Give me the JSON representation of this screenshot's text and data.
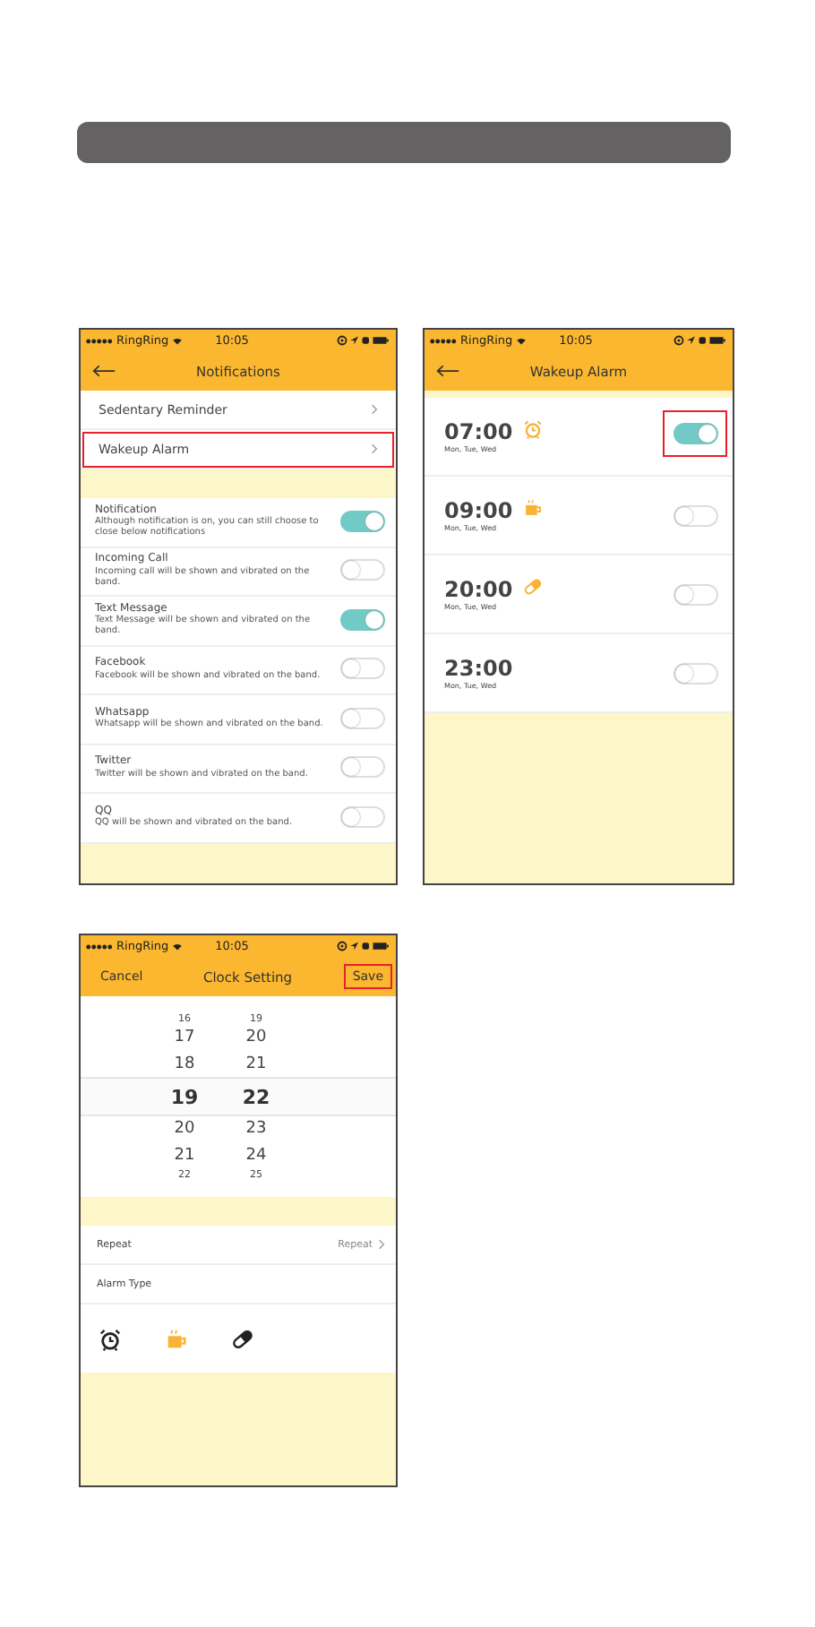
{
  "screens": [
    {
      "kind": "notifications",
      "status_bar": {
        "carrier": "RingRing",
        "time": "10:05"
      },
      "nav": {
        "title": "Notifications"
      },
      "menu": [
        {
          "label": "Sedentary Reminder",
          "highlighted": false
        },
        {
          "label": "Wakeup Alarm",
          "highlighted": true
        }
      ],
      "toggles": [
        {
          "title": "Notification",
          "description": "Although notification is on, you can still choose to close below notifications",
          "on": true
        },
        {
          "title": "Incoming Call",
          "description": "Incoming call will be shown and vibrated on the band.",
          "on": false
        },
        {
          "title": "Text Message",
          "description": "Text Message will be shown and vibrated on the band.",
          "on": true
        },
        {
          "title": "Facebook",
          "description": "Facebook will be shown and vibrated on the band.",
          "on": false
        },
        {
          "title": "Whatsapp",
          "description": "Whatsapp will be shown and vibrated on the band.",
          "on": false
        },
        {
          "title": "Twitter",
          "description": "Twitter will be shown and vibrated on the band.",
          "on": false
        },
        {
          "title": "QQ",
          "description": "QQ will be shown and vibrated on the band.",
          "on": false
        }
      ]
    },
    {
      "kind": "alarms",
      "status_bar": {
        "carrier": "RingRing",
        "time": "10:05"
      },
      "nav": {
        "title": "Wakeup Alarm"
      },
      "alarms": [
        {
          "time": "07:00",
          "days": "Mon, Tue,  Wed",
          "kind": "clock",
          "on": true,
          "highlighted": true
        },
        {
          "time": "09:00",
          "days": "Mon, Tue,  Wed",
          "kind": "cup",
          "on": false,
          "highlighted": false
        },
        {
          "time": "20:00",
          "days": "Mon, Tue,  Wed",
          "kind": "pill",
          "on": false,
          "highlighted": false
        },
        {
          "time": "23:00",
          "days": "Mon, Tue,  Wed",
          "kind": "plain",
          "on": false,
          "highlighted": false
        }
      ]
    },
    {
      "kind": "clock_setting",
      "status_bar": {
        "carrier": "RingRing",
        "time": "10:05"
      },
      "nav": {
        "cancel": "Cancel",
        "title": "Clock Setting",
        "save": "Save",
        "save_highlighted": true
      },
      "picker": [
        {
          "hour": "16",
          "minute": "19",
          "selected": false
        },
        {
          "hour": "17",
          "minute": "20",
          "selected": false
        },
        {
          "hour": "18",
          "minute": "21",
          "selected": false
        },
        {
          "hour": "19",
          "minute": "22",
          "selected": true
        },
        {
          "hour": "20",
          "minute": "23",
          "selected": false
        },
        {
          "hour": "21",
          "minute": "24",
          "selected": false
        },
        {
          "hour": "22",
          "minute": "25",
          "selected": false
        }
      ],
      "repeat": {
        "label": "Repeat",
        "value": "Repeat"
      },
      "alarm_type": {
        "label": "Alarm Type"
      },
      "types": [
        {
          "kind": "clock",
          "selected": false
        },
        {
          "kind": "cup",
          "selected": true
        },
        {
          "kind": "pill",
          "selected": false
        }
      ]
    }
  ]
}
